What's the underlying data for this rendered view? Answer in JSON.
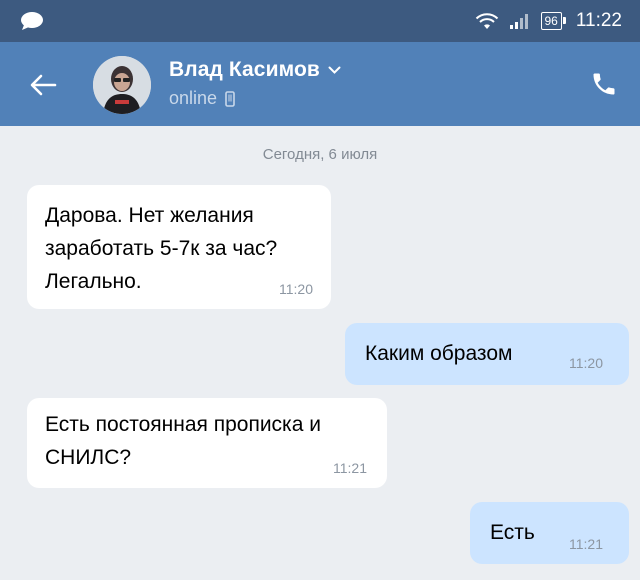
{
  "status_bar": {
    "battery": "96",
    "time": "11:22",
    "icons": [
      "chat-bubble-icon",
      "wifi-icon",
      "signal-icon",
      "battery-icon"
    ]
  },
  "header": {
    "name": "Влад Касимов",
    "status": "online",
    "icons": [
      "back-arrow-icon",
      "chevron-down-icon",
      "mobile-icon",
      "phone-icon"
    ]
  },
  "date_separator": "Сегодня, 6 июля",
  "messages": [
    {
      "direction": "in",
      "text": "Дарова. Нет желания заработать 5-7к за час? Легально.",
      "time": "11:20"
    },
    {
      "direction": "out",
      "text": "Каким образом",
      "time": "11:20"
    },
    {
      "direction": "in",
      "text": "Есть постоянная прописка и СНИЛС?",
      "time": "11:21"
    },
    {
      "direction": "out",
      "text": "Есть",
      "time": "11:21"
    }
  ],
  "colors": {
    "status_bar": "#3d5a80",
    "header": "#5181b8",
    "background": "#ebeef2",
    "incoming_bubble": "#ffffff",
    "outgoing_bubble": "#cce4ff"
  }
}
